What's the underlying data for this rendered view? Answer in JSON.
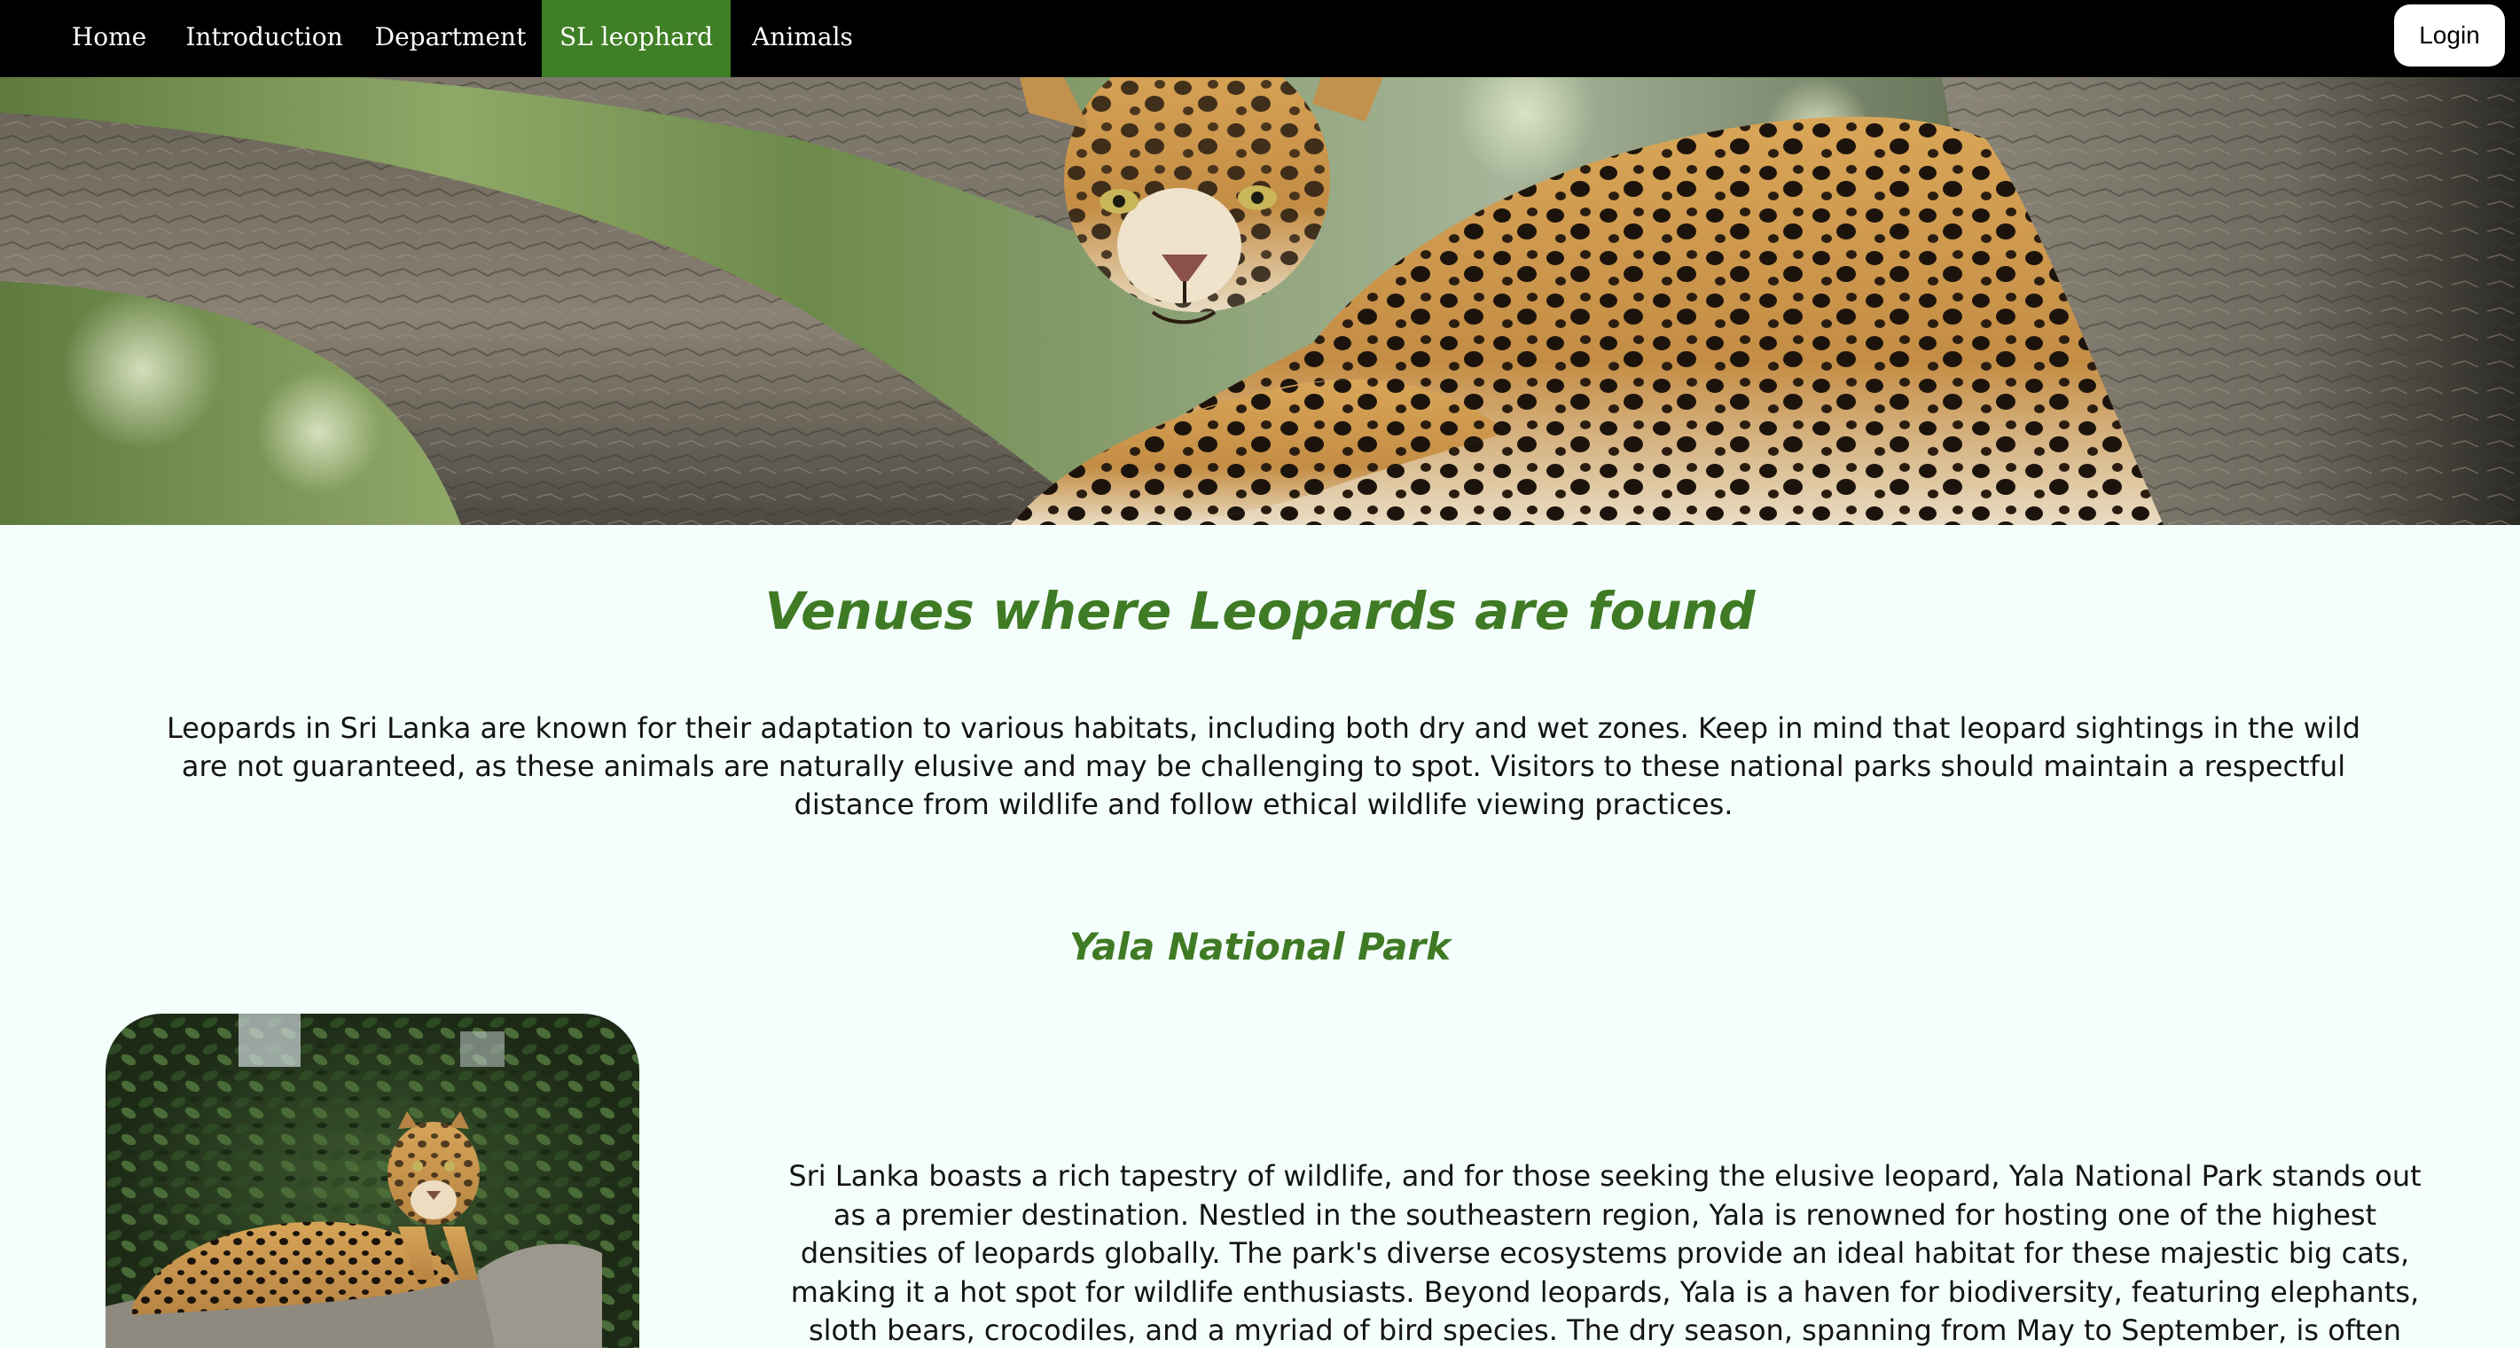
{
  "nav": {
    "items": [
      {
        "label": "Home",
        "active": false
      },
      {
        "label": "Introduction",
        "active": false
      },
      {
        "label": "Department",
        "active": false
      },
      {
        "label": "SL leophard",
        "active": true
      },
      {
        "label": "Animals",
        "active": false
      }
    ],
    "login_label": "Login"
  },
  "colors": {
    "nav_bg": "#000000",
    "active_tab": "#3f7f25",
    "heading": "#3f7a24",
    "page_bg": "#f4fffd"
  },
  "main": {
    "title": "Venues where Leopards are found",
    "intro": "Leopards in Sri Lanka are known for their adaptation to various habitats, including both dry and wet zones. Keep in mind that leopard sightings in the wild are not guaranteed, as these animals are naturally elusive and may be challenging to spot. Visitors to these national parks should maintain a respectful distance from wildlife and follow ethical wildlife viewing practices.",
    "sections": [
      {
        "heading": "Yala National Park",
        "text": "Sri Lanka boasts a rich tapestry of wildlife, and for those seeking the elusive leopard, Yala National Park stands out as a premier destination. Nestled in the southeastern region, Yala is renowned for hosting one of the highest densities of leopards globally. The park's diverse ecosystems provide an ideal habitat for these majestic big cats, making it a hot spot for wildlife enthusiasts. Beyond leopards, Yala is a haven for biodiversity, featuring elephants, sloth bears, crocodiles, and a myriad of bird species. The dry season, spanning from May to September, is often"
      }
    ]
  }
}
